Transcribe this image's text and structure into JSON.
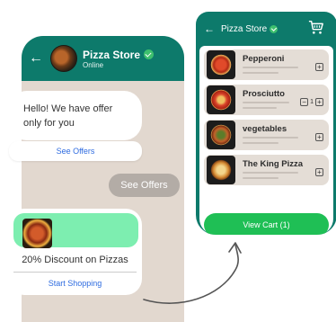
{
  "chat": {
    "back_icon": "arrow-left-icon",
    "store_name": "Pizza Store",
    "status": "Online",
    "verified_icon": "verified-check-icon",
    "offer_message": "Hello! We have offer only for you",
    "see_offers_link": "See Offers",
    "reply_message": "See Offers",
    "promo": {
      "text": "20% Discount on Pizzas",
      "cta": "Start Shopping"
    }
  },
  "store": {
    "back_icon": "arrow-left-icon",
    "title": "Pizza Store",
    "cart_icon": "shopping-cart-icon",
    "products": [
      {
        "name": "Pepperoni",
        "control": "plus"
      },
      {
        "name": "Prosciutto",
        "control": "stepper",
        "quantity": "1"
      },
      {
        "name": "vegetables",
        "control": "plus"
      },
      {
        "name": "The King Pizza",
        "control": "plus"
      }
    ],
    "view_cart": "View Cart (1)",
    "plus_symbol": "+",
    "minus_symbol": "−"
  },
  "colors": {
    "brand_teal": "#0d7a6b",
    "chat_bg": "#e2d8cf",
    "accent_green": "#1fbf55",
    "promo_mint": "#7deeb0",
    "link_blue": "#2f6ce0",
    "reply_grey": "#b3aca6"
  }
}
